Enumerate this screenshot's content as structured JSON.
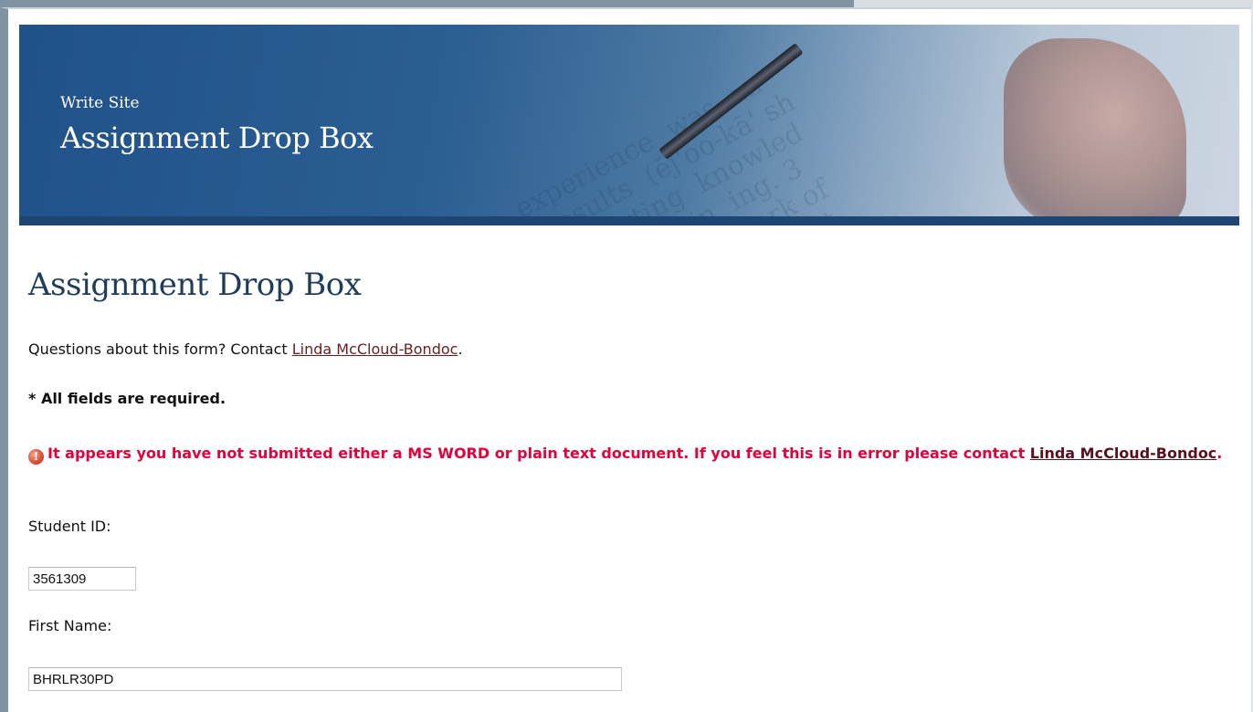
{
  "banner": {
    "site_name": "Write Site",
    "title": "Assignment Drop Box"
  },
  "page": {
    "title": "Assignment Drop Box",
    "contact_prefix": "Questions about this form? Contact ",
    "contact_name": "Linda McCloud-Bondoc",
    "contact_suffix": ".",
    "required_note": "* All fields are required."
  },
  "error": {
    "icon": "error-exclamation-icon",
    "message": "It appears you have not submitted either a MS WORD or plain text document. If you feel this is in error please contact ",
    "contact_name": "Linda McCloud-Bondoc",
    "suffix": "."
  },
  "form": {
    "student_id": {
      "label": "Student ID:",
      "value": "3561309"
    },
    "first_name": {
      "label": "First Name:",
      "value": "BHRLR30PD"
    }
  },
  "colors": {
    "banner_blue": "#2b5e92",
    "title_navy": "#1d3c5e",
    "error_red": "#e4003a",
    "link_maroon": "#6b1c1c"
  }
}
